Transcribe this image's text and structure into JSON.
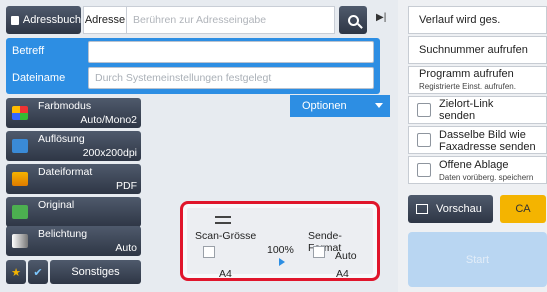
{
  "top": {
    "addressbook": "Adressbuch",
    "address_label": "Adresse",
    "address_placeholder": "Berühren zur Adresseingabe"
  },
  "fields": {
    "subject_label": "Betreff",
    "filename_label": "Dateiname",
    "filename_placeholder": "Durch Systemeinstellungen festgelegt"
  },
  "options_label": "Optionen",
  "modes": [
    {
      "label": "Farbmodus",
      "value": "Auto/Mono2",
      "icon": "color-mode-icon"
    },
    {
      "label": "Auflösung",
      "value": "200x200dpi",
      "icon": "resolution-icon"
    },
    {
      "label": "Dateiformat",
      "value": "PDF",
      "icon": "file-format-icon"
    },
    {
      "label": "Original",
      "value": "",
      "icon": "original-icon"
    },
    {
      "label": "Belichtung",
      "value": "Auto",
      "icon": "exposure-icon"
    }
  ],
  "tray": {
    "others": "Sonstiges"
  },
  "panel": {
    "scan_size_label": "Scan-Grösse",
    "ratio": "100%",
    "send_format_label": "Sende-Format",
    "send_auto": "Auto",
    "scan_paper": "A4",
    "send_paper": "A4"
  },
  "right": {
    "history": "Verlauf wird ges.",
    "call_search": "Suchnummer aufrufen",
    "call_program": "Programm aufrufen",
    "call_program_sub": "Registrierte Einst. aufrufen.",
    "dest_link": "Zielort-Link senden",
    "same_image_1": "Dasselbe Bild wie",
    "same_image_2": "Faxadresse senden",
    "open_store": "Offene Ablage",
    "open_store_sub": "Daten vorüberg. speichern",
    "preview": "Vorschau",
    "ca": "CA",
    "start": "Start"
  }
}
